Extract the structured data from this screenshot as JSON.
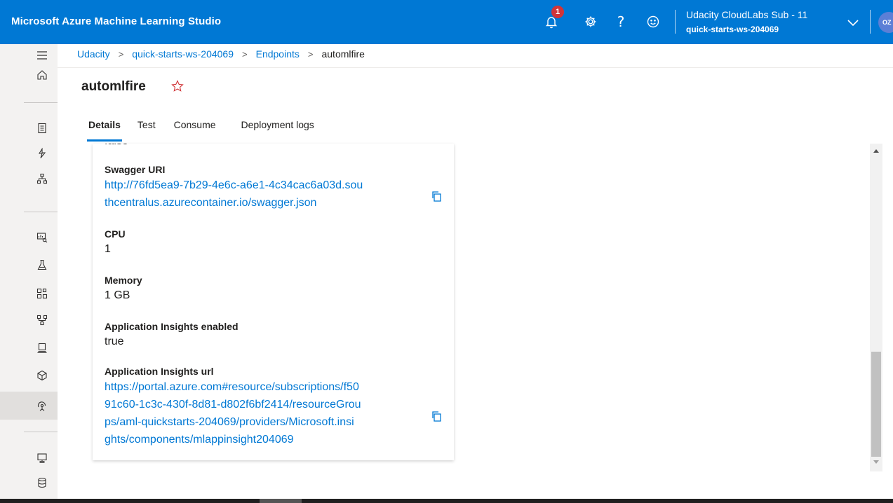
{
  "header": {
    "app_title": "Microsoft Azure Machine Learning Studio",
    "notification_count": "1",
    "subscription_name": "Udacity CloudLabs Sub - 11",
    "workspace_name": "quick-starts-ws-204069",
    "avatar_initials": "OZ",
    "accent_color": "#0078d4"
  },
  "breadcrumb": {
    "items": [
      "Udacity",
      "quick-starts-ws-204069",
      "Endpoints"
    ],
    "current": "automlfire",
    "separator": ">"
  },
  "page": {
    "title": "automlfire",
    "favorite_icon": "star-outline-icon"
  },
  "tabs": [
    {
      "label": "Details",
      "active": true
    },
    {
      "label": "Test",
      "active": false
    },
    {
      "label": "Consume",
      "active": false
    },
    {
      "label": "Deployment logs",
      "active": false
    }
  ],
  "details": {
    "partial_value": "false",
    "swagger_label": "Swagger URI",
    "swagger_url_line1": "http://76fd5ea9-7b29-4e6c-a6e1-4c34cac6a03d.sou",
    "swagger_url_line2": "thcentralus.azurecontainer.io/swagger.json",
    "cpu_label": "CPU",
    "cpu_value": "1",
    "memory_label": "Memory",
    "memory_value": "1 GB",
    "insights_enabled_label": "Application Insights enabled",
    "insights_enabled_value": "true",
    "insights_url_label": "Application Insights url",
    "insights_url_line1": "https://portal.azure.com#resource/subscriptions/f50",
    "insights_url_line2": "91c60-1c3c-430f-8d81-d802f6bf2414/resourceGrou",
    "insights_url_line3": "ps/aml-quickstarts-204069/providers/Microsoft.insi",
    "insights_url_line4": "ghts/components/mlappinsight204069"
  },
  "nav_icons": [
    "menu-icon",
    "home-icon",
    "notebooks-icon",
    "automl-icon",
    "designer-icon",
    "datasets-icon",
    "experiments-icon",
    "pipelines-icon",
    "models-icon",
    "compute-icon",
    "environments-icon",
    "endpoints-icon",
    "compute-instances-icon",
    "datastores-icon"
  ]
}
